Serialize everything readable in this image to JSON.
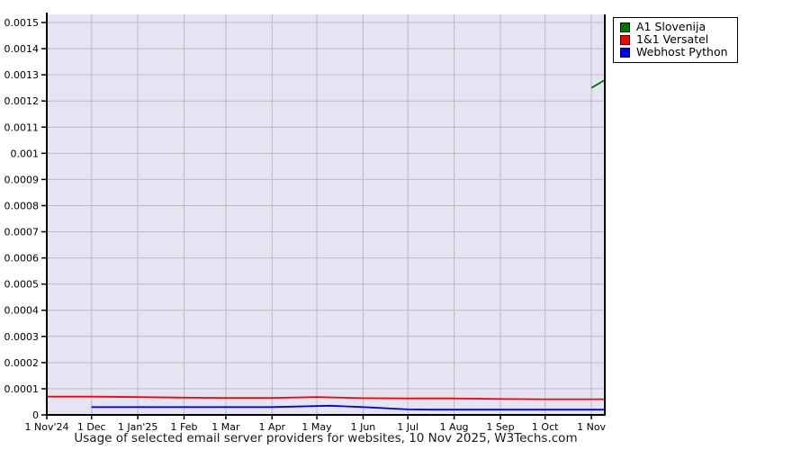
{
  "title": "Usage of selected email server providers for websites, 10 Nov 2025, W3Techs.com",
  "colors": {
    "page_bg": "#ffffff",
    "plot_bg": "#e4e4f5",
    "grid": "#bcbcbc",
    "axis": "#000000",
    "legend_bg": "#ffffff",
    "legend_border": "#000000"
  },
  "chart_data": {
    "type": "line",
    "title": "Usage of selected email server providers for websites, 10 Nov 2025, W3Techs.com",
    "x_unit": "days since 1 Nov 2024",
    "x_range": [
      0,
      374
    ],
    "ylim": [
      0,
      0.0015
    ],
    "grid": true,
    "legend_position": "outside-top-right",
    "x_ticks": [
      {
        "day": 0,
        "label": "1 Nov'24"
      },
      {
        "day": 30,
        "label": "1 Dec"
      },
      {
        "day": 61,
        "label": "1 Jan'25"
      },
      {
        "day": 92,
        "label": "1 Feb"
      },
      {
        "day": 120,
        "label": "1 Mar"
      },
      {
        "day": 151,
        "label": "1 Apr"
      },
      {
        "day": 181,
        "label": "1 May"
      },
      {
        "day": 212,
        "label": "1 Jun"
      },
      {
        "day": 242,
        "label": "1 Jul"
      },
      {
        "day": 273,
        "label": "1 Aug"
      },
      {
        "day": 304,
        "label": "1 Sep"
      },
      {
        "day": 334,
        "label": "1 Oct"
      },
      {
        "day": 365,
        "label": "1 Nov"
      }
    ],
    "y_ticks": [
      {
        "value": 0,
        "label": "0"
      },
      {
        "value": 0.0001,
        "label": "0.0001"
      },
      {
        "value": 0.0002,
        "label": "0.0002"
      },
      {
        "value": 0.0003,
        "label": "0.0003"
      },
      {
        "value": 0.0004,
        "label": "0.0004"
      },
      {
        "value": 0.0005,
        "label": "0.0005"
      },
      {
        "value": 0.0006,
        "label": "0.0006"
      },
      {
        "value": 0.0007,
        "label": "0.0007"
      },
      {
        "value": 0.0008,
        "label": "0.0008"
      },
      {
        "value": 0.0009,
        "label": "0.0009"
      },
      {
        "value": 0.001,
        "label": "0.001"
      },
      {
        "value": 0.0011,
        "label": "0.0011"
      },
      {
        "value": 0.0012,
        "label": "0.0012"
      },
      {
        "value": 0.0013,
        "label": "0.0013"
      },
      {
        "value": 0.0014,
        "label": "0.0014"
      },
      {
        "value": 0.0015,
        "label": "0.0015"
      }
    ],
    "series": [
      {
        "name": "A1 Slovenija",
        "color": "#007300",
        "points": [
          {
            "day": 365,
            "value": 0.00125
          },
          {
            "day": 374,
            "value": 0.00128
          }
        ]
      },
      {
        "name": "1&1 Versatel",
        "color": "#ff0000",
        "points": [
          {
            "day": 0,
            "value": 7e-05
          },
          {
            "day": 30,
            "value": 7e-05
          },
          {
            "day": 61,
            "value": 6.8e-05
          },
          {
            "day": 92,
            "value": 6.6e-05
          },
          {
            "day": 120,
            "value": 6.5e-05
          },
          {
            "day": 151,
            "value": 6.5e-05
          },
          {
            "day": 181,
            "value": 6.8e-05
          },
          {
            "day": 212,
            "value": 6.4e-05
          },
          {
            "day": 242,
            "value": 6.3e-05
          },
          {
            "day": 273,
            "value": 6.3e-05
          },
          {
            "day": 304,
            "value": 6.1e-05
          },
          {
            "day": 334,
            "value": 6e-05
          },
          {
            "day": 365,
            "value": 6e-05
          },
          {
            "day": 374,
            "value": 6e-05
          }
        ]
      },
      {
        "name": "Webhost Python",
        "color": "#0000ee",
        "points": [
          {
            "day": 30,
            "value": 3e-05
          },
          {
            "day": 61,
            "value": 3e-05
          },
          {
            "day": 92,
            "value": 3e-05
          },
          {
            "day": 120,
            "value": 3e-05
          },
          {
            "day": 151,
            "value": 3e-05
          },
          {
            "day": 190,
            "value": 3.5e-05
          },
          {
            "day": 212,
            "value": 3e-05
          },
          {
            "day": 242,
            "value": 2.1e-05
          },
          {
            "day": 258,
            "value": 2e-05
          },
          {
            "day": 273,
            "value": 2e-05
          },
          {
            "day": 304,
            "value": 2e-05
          },
          {
            "day": 334,
            "value": 2e-05
          },
          {
            "day": 365,
            "value": 2e-05
          },
          {
            "day": 374,
            "value": 2e-05
          }
        ]
      }
    ]
  }
}
